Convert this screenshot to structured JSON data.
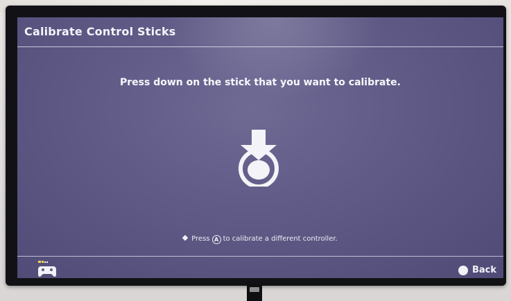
{
  "header": {
    "title": "Calibrate Control Sticks"
  },
  "main": {
    "instruction": "Press down on the stick that you want to calibrate.",
    "icon": "press-down-stick-icon"
  },
  "hint": {
    "prefix": "Press",
    "button_glyph": "A",
    "suffix": "to calibrate a different controller."
  },
  "footer": {
    "controller_icon": "controller-icon",
    "back_label": "Back"
  },
  "colors": {
    "screen_bg": "#5f5a86",
    "text": "#f2f2f8"
  }
}
